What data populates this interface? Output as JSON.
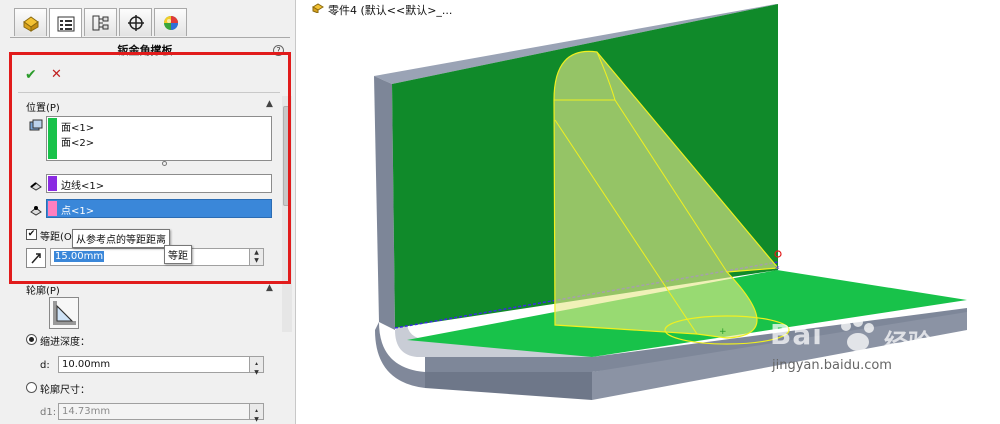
{
  "document": {
    "title": "零件4 (默认<<默认>_..."
  },
  "panel": {
    "tabs": [
      "feature-manager",
      "property-manager",
      "configuration-manager",
      "dimxpert-manager",
      "display-manager"
    ],
    "title": "钣金角撑板",
    "help_icon": "?",
    "ok_label": "✔",
    "cancel_label": "✕",
    "position_group": {
      "title": "位置(P)",
      "faces": [
        "面<1>",
        "面<2>"
      ],
      "face_color": "#18c24a",
      "edge": "边线<1>",
      "edge_color": "#8a2be2",
      "point": "点<1>",
      "point_color": "#ff7fbf",
      "equidistant_checked": true,
      "equidistant_label": "等距(O",
      "offset_value": "15.00mm"
    },
    "tooltip": "从参考点的等距距离",
    "tooltip2": "等距",
    "profile_group": {
      "title": "轮廓(P)",
      "indent_depth_label": "缩进深度：",
      "indent_depth_selected": true,
      "d_label": "d:",
      "d_value": "10.00mm",
      "profile_size_label": "轮廓尺寸：",
      "profile_size_selected": false,
      "d1_label": "d1:",
      "d1_value": "14.73mm"
    }
  },
  "watermark": {
    "main": "Bai",
    "brand": "经验",
    "sub": "jingyan.baidu.com"
  }
}
